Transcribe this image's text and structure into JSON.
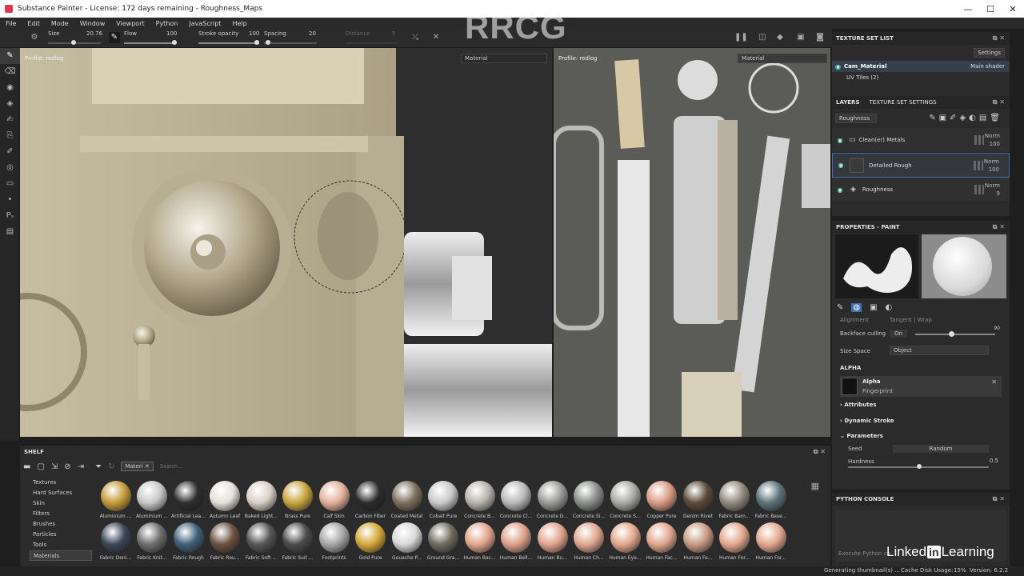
{
  "window": {
    "title": "Substance Painter - License: 172 days remaining - Roughness_Maps",
    "controls": [
      "—",
      "☐",
      "✕"
    ]
  },
  "menu": [
    "File",
    "Edit",
    "Mode",
    "Window",
    "Viewport",
    "Python",
    "JavaScript",
    "Help"
  ],
  "toolbar": {
    "size_label": "Size",
    "size_value": "20.76",
    "flow_label": "Flow",
    "flow_value": "100",
    "stroke_opacity_label": "Stroke opacity",
    "stroke_opacity_value": "100",
    "spacing_label": "Spacing",
    "spacing_value": "20",
    "distance_label": "Distance",
    "distance_value": "5"
  },
  "viewport3d": {
    "profile": "Profile: redlog",
    "mode": "Material"
  },
  "viewport2d": {
    "profile": "Profile: redlog",
    "mode": "Material"
  },
  "texture_set_list": {
    "title": "TEXTURE SET LIST",
    "settings_label": "Settings",
    "material": "Cam_Material",
    "shader": "Main shader",
    "uv_tiles": "UV Tiles (2)"
  },
  "layers": {
    "tab_layers": "LAYERS",
    "tab_texture_set_settings": "TEXTURE SET SETTINGS",
    "channel": "Roughness",
    "items": [
      {
        "name": "Clean(er) Metals",
        "blend": "Norm",
        "opacity": "100"
      },
      {
        "name": "Detailed Rough",
        "blend": "Norm",
        "opacity": "100"
      },
      {
        "name": "Roughness",
        "blend": "Norm",
        "opacity": "9"
      }
    ]
  },
  "properties": {
    "title": "PROPERTIES - PAINT",
    "alignment_label": "Alignment",
    "alignment_value": "Tangent | Wrap",
    "backface_label": "Backface culling",
    "backface_value": "On",
    "backface_number": "90",
    "size_space_label": "Size Space",
    "size_space_value": "Object",
    "alpha_section": "ALPHA",
    "alpha_name": "Alpha",
    "alpha_value": "Fingerprint",
    "attributes": "Attributes",
    "dynamic_stroke": "Dynamic Stroke",
    "parameters": "Parameters",
    "seed_label": "Seed",
    "seed_value": "Random",
    "hardness_label": "Hardness",
    "hardness_value": "0.5"
  },
  "python_console": {
    "title": "PYTHON CONSOLE",
    "prompt": "Execute Python co"
  },
  "shelf": {
    "title": "SHELF",
    "filter_tag": "Materi",
    "search_placeholder": "Search...",
    "categories": [
      "Textures",
      "Hard Surfaces",
      "Skin",
      "Filters",
      "Brushes",
      "Particles",
      "Tools",
      "Materials"
    ],
    "materials_row1": [
      {
        "name": "Aluminium ...",
        "color": "#c59a3a"
      },
      {
        "name": "Aluminium ...",
        "color": "#c8c8c8"
      },
      {
        "name": "Artificial Lea...",
        "color": "#2e2e2e"
      },
      {
        "name": "Autumn Leaf",
        "color": "#e4e0da"
      },
      {
        "name": "Baked Light...",
        "color": "#d8cfc6"
      },
      {
        "name": "Brass Pure",
        "color": "#c7a640"
      },
      {
        "name": "Calf Skin",
        "color": "#e3b09a"
      },
      {
        "name": "Carbon Fiber",
        "color": "#2b2b2b"
      },
      {
        "name": "Coated Metal",
        "color": "#7d6f5f"
      },
      {
        "name": "Cobalt Pure",
        "color": "#c9c9c9"
      },
      {
        "name": "Concrete B...",
        "color": "#b7b3ad"
      },
      {
        "name": "Concrete Cl...",
        "color": "#b9b9b9"
      },
      {
        "name": "Concrete D...",
        "color": "#9a9a98"
      },
      {
        "name": "Concrete Si...",
        "color": "#8a8d8a"
      },
      {
        "name": "Concrete S...",
        "color": "#a9a9a7"
      },
      {
        "name": "Copper Pure",
        "color": "#d99a84"
      },
      {
        "name": "Denim Rivet",
        "color": "#5c4a3a"
      },
      {
        "name": "Fabric Bam...",
        "color": "#8f8a7e"
      },
      {
        "name": "Fabric Base...",
        "color": "#5c7279"
      }
    ],
    "materials_row2": [
      {
        "name": "Fabric Deni...",
        "color": "#3c4656"
      },
      {
        "name": "Fabric Knit...",
        "color": "#6d6d6d"
      },
      {
        "name": "Fabric Rough",
        "color": "#3e5f79"
      },
      {
        "name": "Fabric Rou...",
        "color": "#6b5140"
      },
      {
        "name": "Fabric Soft ...",
        "color": "#555555"
      },
      {
        "name": "Fabric Suit ...",
        "color": "#4b4b4b"
      },
      {
        "name": "Footprints",
        "color": "#a6a6a6"
      },
      {
        "name": "Gold Pure",
        "color": "#d4a739"
      },
      {
        "name": "Gouache P...",
        "color": "#d8d8d8"
      },
      {
        "name": "Ground Gra...",
        "color": "#6d6a5d"
      },
      {
        "name": "Human Bac...",
        "color": "#e2a58d"
      },
      {
        "name": "Human Bell...",
        "color": "#dda08a"
      },
      {
        "name": "Human Bu...",
        "color": "#e1a48e"
      },
      {
        "name": "Human Ch...",
        "color": "#dfa78f"
      },
      {
        "name": "Human Eye...",
        "color": "#e2a68d"
      },
      {
        "name": "Human Fac...",
        "color": "#e0a58c"
      },
      {
        "name": "Human Fe...",
        "color": "#c79b83"
      },
      {
        "name": "Human For...",
        "color": "#e3a78d"
      },
      {
        "name": "Human For...",
        "color": "#e4a88f"
      }
    ]
  },
  "status": {
    "left": "Generating thumbnail(s) ...",
    "cache": "Cache Disk Usage:",
    "cache_value": "15%",
    "version": "Version: 6.2.2"
  },
  "watermark": "RRCG",
  "linkedin": {
    "left": "Linked",
    "in": "in",
    "right": "Learning"
  },
  "colors": {
    "accent": "#3e6fb0",
    "panel": "#2b2b2b",
    "bg": "#1e1e1e"
  }
}
